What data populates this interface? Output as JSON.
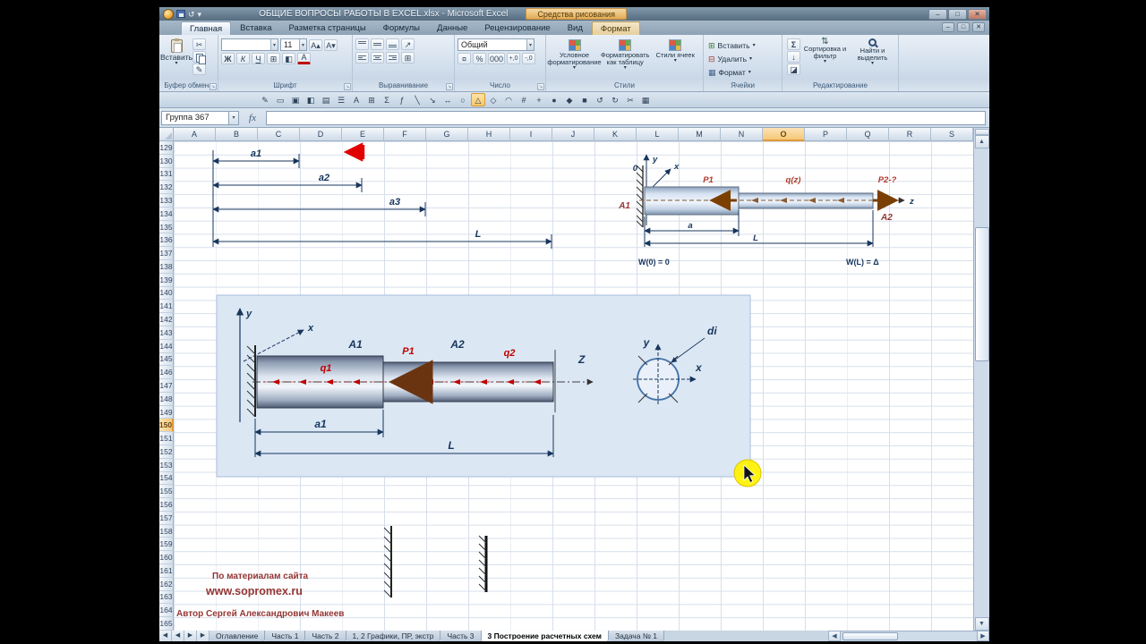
{
  "window": {
    "title": "ОБЩИЕ ВОПРОСЫ РАБОТЫ В EXCEL.xlsx - Microsoft Excel",
    "context_header": "Средства рисования",
    "controls": {
      "minimize": "‒",
      "maximize": "□",
      "close": "✕"
    }
  },
  "quick_access": {
    "undo": "↺",
    "dropdown": "▾"
  },
  "ribbon_tabs": [
    {
      "label": "Главная",
      "active": true
    },
    {
      "label": "Вставка"
    },
    {
      "label": "Разметка страницы"
    },
    {
      "label": "Формулы"
    },
    {
      "label": "Данные"
    },
    {
      "label": "Рецензирование"
    },
    {
      "label": "Вид"
    },
    {
      "label": "Формат",
      "context": true
    }
  ],
  "ribbon": {
    "clipboard": {
      "group": "Буфер обмена",
      "paste": "Вставить",
      "dropdown": "▾",
      "scissors": "✂",
      "painter": "✎"
    },
    "font": {
      "group": "Шрифт",
      "size": "11",
      "bold": "Ж",
      "italic": "К",
      "underline": "Ч",
      "grow": "А▴",
      "shrink": "А▾",
      "border": "⊞",
      "fill": "◧",
      "color": "А",
      "dropdown": "▾"
    },
    "alignment": {
      "group": "Выравнивание",
      "orientation": "↗",
      "merge": "⊞",
      "dropdown": "▾"
    },
    "number": {
      "group": "Число",
      "format": "Общий",
      "currency": "¤",
      "percent": "%",
      "thousands": "000",
      "inc": "+,0",
      "dec": "-,0",
      "dropdown": "▾"
    },
    "styles": {
      "group": "Стили",
      "conditional": "Условное форматирование",
      "table": "Форматировать как таблицу",
      "cell_styles": "Стили ячеек",
      "dropdown": "▾"
    },
    "cells": {
      "group": "Ячейки",
      "insert": "Вставить",
      "del": "Удалить",
      "format": "Формат",
      "insert_icon": "⊞",
      "delete_icon": "⊟",
      "format_icon": "▦",
      "dropdown": "▾"
    },
    "editing": {
      "group": "Редактирование",
      "sum": "Σ",
      "fill": "↓",
      "clear": "◪",
      "sort_icon": "⇅",
      "sort": "Сортировка и фильтр",
      "find": "Найти и выделить",
      "dropdown": "▾"
    }
  },
  "draw_toolbar": {
    "active_index": 14,
    "icons": [
      "✎",
      "▭",
      "▣",
      "◧",
      "▤",
      "☰",
      "А",
      "⊞",
      "Σ",
      "ƒ",
      "╲",
      "↘",
      "↔",
      "○",
      "△",
      "◇",
      "◠",
      "#",
      "+",
      "●",
      "◆",
      "■",
      "↺",
      "↻",
      "✂",
      "▦"
    ]
  },
  "formula_bar": {
    "name_box": "Группа 367",
    "dropdown": "▾",
    "fx": "fx"
  },
  "grid": {
    "columns": [
      "A",
      "B",
      "C",
      "D",
      "E",
      "F",
      "G",
      "H",
      "I",
      "J",
      "K",
      "L",
      "M",
      "N",
      "O",
      "P",
      "Q",
      "R",
      "S"
    ],
    "rows": [
      "129",
      "130",
      "131",
      "132",
      "133",
      "134",
      "135",
      "136",
      "137",
      "138",
      "139",
      "140",
      "141",
      "142",
      "143",
      "144",
      "145",
      "146",
      "147",
      "148",
      "149",
      "150",
      "151",
      "152",
      "153",
      "154",
      "155",
      "156",
      "157",
      "158",
      "159",
      "160",
      "161",
      "162",
      "163",
      "164",
      "165"
    ],
    "selected_column": "O",
    "selected_row": "150"
  },
  "tab_nav": [
    "◀",
    "◀",
    "▶",
    "▶"
  ],
  "scrollbar": {
    "up": "▲",
    "down": "▼",
    "left": "◀",
    "right": "▶"
  },
  "diagram": {
    "dims": {
      "a1": "a1",
      "a2": "a2",
      "a3": "a3",
      "L": "L"
    },
    "top": {
      "y": "y",
      "x": "x",
      "zero": "0",
      "a1": "A1",
      "p1": "P1",
      "qz": "q(z)",
      "p2": "P2-?",
      "a2": "A2",
      "z": "z",
      "a": "a",
      "L": "L",
      "w0": "W(0) = 0",
      "wl": "W(L) = Δ"
    },
    "mid": {
      "y": "y",
      "x": "x",
      "a1": "A1",
      "p1": "P1",
      "a2": "A2",
      "q1": "q1",
      "q2": "q2",
      "z": "Z",
      "dim_a1": "a1",
      "dim_L": "L",
      "sec_y": "y",
      "sec_x": "x",
      "di": "di"
    }
  },
  "footer": {
    "line1": "По материалам сайта",
    "line2": "www.sopromex.ru",
    "line3": "Автор Сергей Александрович Макеев"
  },
  "sheet_tabs": [
    {
      "label": "Оглавление"
    },
    {
      "label": "Часть 1"
    },
    {
      "label": "Часть 2"
    },
    {
      "label": "1, 2 Графики, ПР, экстр"
    },
    {
      "label": "Часть 3"
    },
    {
      "label": "3 Построение расчетных схем",
      "active": true
    },
    {
      "label": "Задача № 1"
    }
  ],
  "colors": {
    "selection": "#F7C66B",
    "grid_line": "#D7DFEB",
    "label_navy": "#17365D",
    "label_red": "#C00000",
    "label_maroon": "#943634"
  }
}
